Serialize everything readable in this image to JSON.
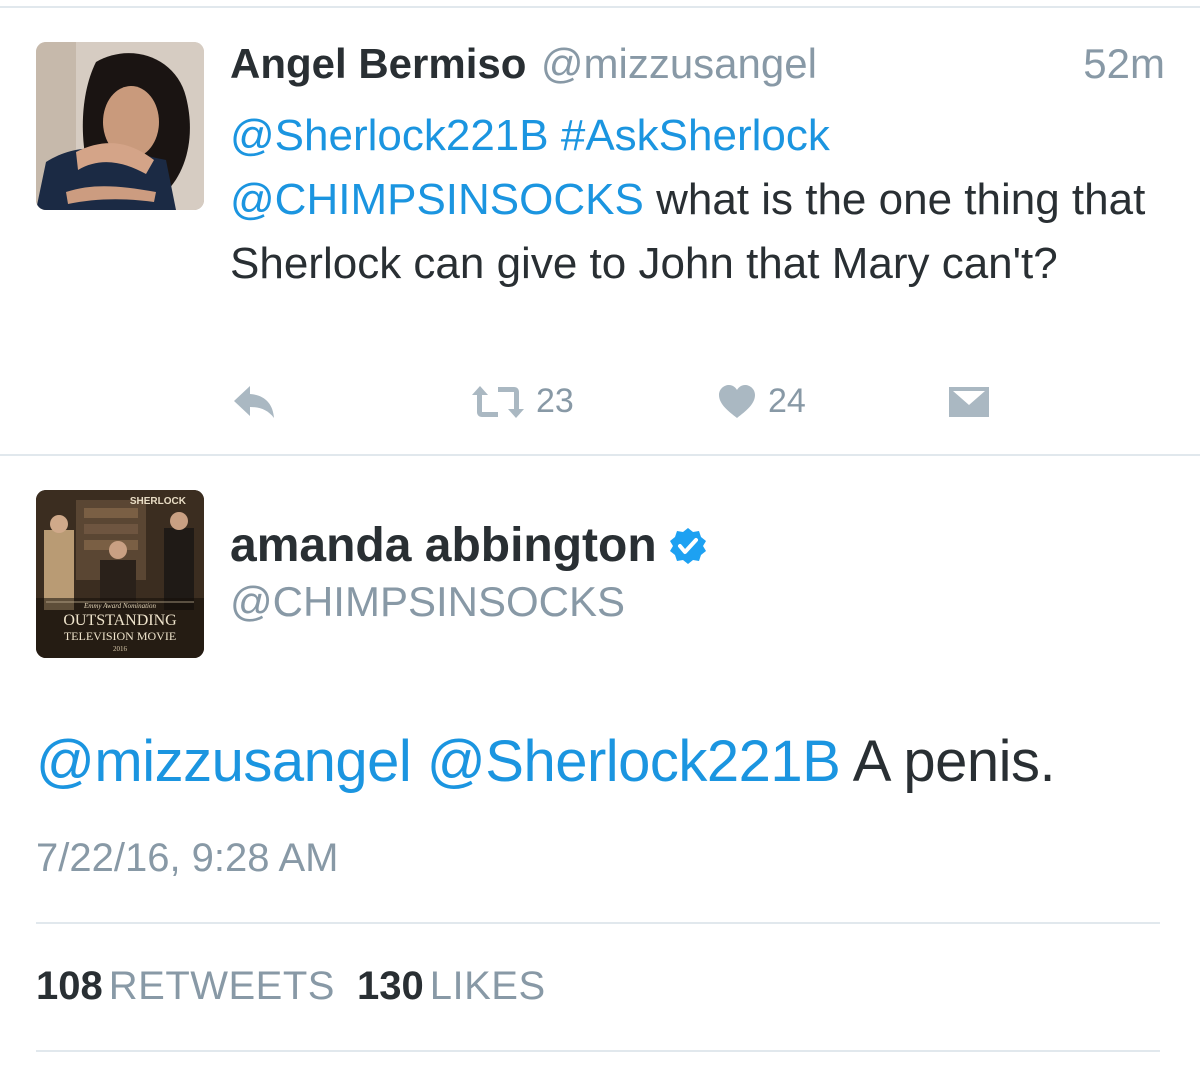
{
  "tweet1": {
    "name": "Angel Bermiso",
    "handle": "@mizzusangel",
    "time": "52m",
    "mention1": "@Sherlock221B",
    "hashtag": "#AskSherlock",
    "mention2": "@CHIMPSINSOCKS",
    "body_text": " what is the one thing that Sherlock can give to John that Mary can't?",
    "retweet_count": "23",
    "like_count": "24"
  },
  "tweet2": {
    "name": "amanda abbington",
    "handle": "@CHIMPSINSOCKS",
    "avatar_text": {
      "brand": "SHERLOCK",
      "tagline": "Emmy Award Nomination",
      "line1": "OUTSTANDING",
      "line2": "TELEVISION MOVIE",
      "year": "2016"
    },
    "mention1": "@mizzusangel",
    "mention2": "@Sherlock221B",
    "body_text": " A penis.",
    "date": "7/22/16, 9:28 AM",
    "retweets_count": "108",
    "retweets_label": "RETWEETS",
    "likes_count": "130",
    "likes_label": "LIKES"
  },
  "icons": {
    "reply": "reply-icon",
    "retweet": "retweet-icon",
    "like": "heart-icon",
    "dm": "envelope-icon",
    "verified": "verified-badge-icon"
  },
  "colors": {
    "link": "#1b95e0",
    "text": "#292f33",
    "secondary": "#8899a6",
    "icon": "#aab8c2",
    "verified": "#1da1f2",
    "divider": "#e1e8ed"
  }
}
